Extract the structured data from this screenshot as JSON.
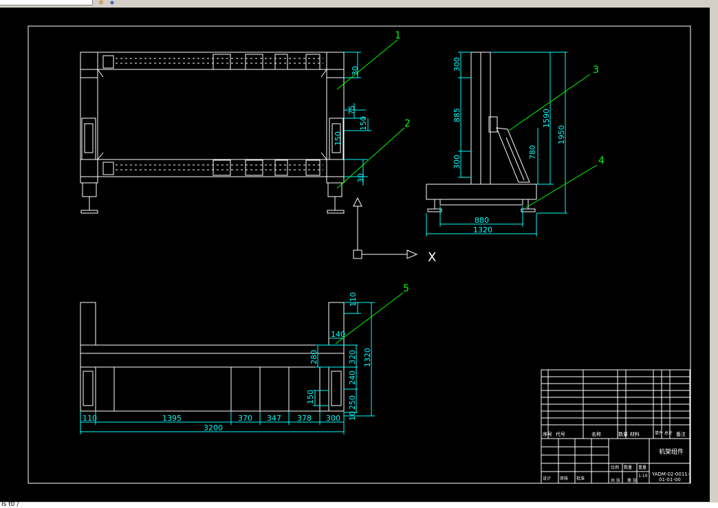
{
  "app": {
    "command_line_text": "Is    t0 /",
    "toolbar_icons": [
      "snap-icon",
      "shape-icon"
    ]
  },
  "colors": {
    "background": "#000000",
    "lines": "#ffffff",
    "dimensions": "#00ffff",
    "leaders": "#00ff00"
  },
  "drawing": {
    "leader_numbers": [
      "1",
      "2",
      "3",
      "4",
      "5"
    ],
    "front_view": {
      "dims": [
        "30",
        "75",
        "150",
        "150",
        "30"
      ]
    },
    "side_view": {
      "dims": [
        "300",
        "885",
        "300",
        "1590",
        "1950",
        "780",
        "880",
        "1320"
      ]
    },
    "top_view": {
      "vdims": [
        "110",
        "140",
        "280",
        "320",
        "240",
        "250",
        "150",
        "10",
        "1320"
      ],
      "hdims": [
        "110",
        "1395",
        "370",
        "347",
        "378",
        "300"
      ],
      "total": "3200"
    },
    "ucs": {
      "x_label": "X"
    },
    "title_block": {
      "title": "机架组件",
      "drawing_number_line1": "YADM-02-0011-",
      "drawing_number_line2": "01-01-00",
      "header_cells": [
        "序号",
        "代号",
        "名称",
        "数量",
        "材料",
        "单件 总计",
        "备注"
      ],
      "cells": [
        "比例",
        "数量",
        "重量",
        "1:10",
        "设计",
        "审核",
        "批准",
        "共 张",
        "第 张"
      ]
    }
  }
}
